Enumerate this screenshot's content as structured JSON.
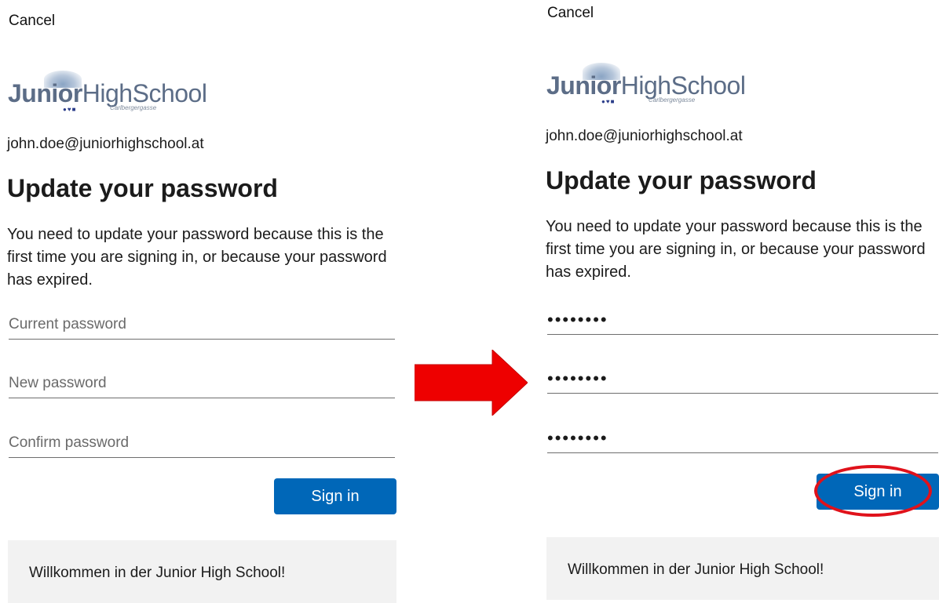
{
  "before": {
    "cancel_label": "Cancel",
    "logo": {
      "part1": "Junior",
      "part2": "HighSchool",
      "subtitle": "Carlbergergasse"
    },
    "email": "john.doe@juniorhighschool.at",
    "title": "Update your password",
    "description": "You need to update your password because this is the first time you are signing in, or because your password has expired.",
    "fields": {
      "current_placeholder": "Current password",
      "new_placeholder": "New password",
      "confirm_placeholder": "Confirm password"
    },
    "sign_in_label": "Sign in",
    "footer_text": "Willkommen in der Junior High School!"
  },
  "after": {
    "cancel_label": "Cancel",
    "logo": {
      "part1": "Junior",
      "part2": "HighSchool",
      "subtitle": "Carlbergergasse"
    },
    "email": "john.doe@juniorhighschool.at",
    "title": "Update your password",
    "description": "You need to update your password because this is the first time you are signing in, or because your password has expired.",
    "fields": {
      "current_value": "••••••••",
      "new_value": "••••••••",
      "confirm_value": "••••••••"
    },
    "sign_in_label": "Sign in",
    "footer_text": "Willkommen in der Junior High School!"
  },
  "colors": {
    "primary_button": "#0067b8",
    "arrow": "#ee0000",
    "highlight_ring": "#e0121b",
    "footer_bg": "#f2f2f2"
  }
}
